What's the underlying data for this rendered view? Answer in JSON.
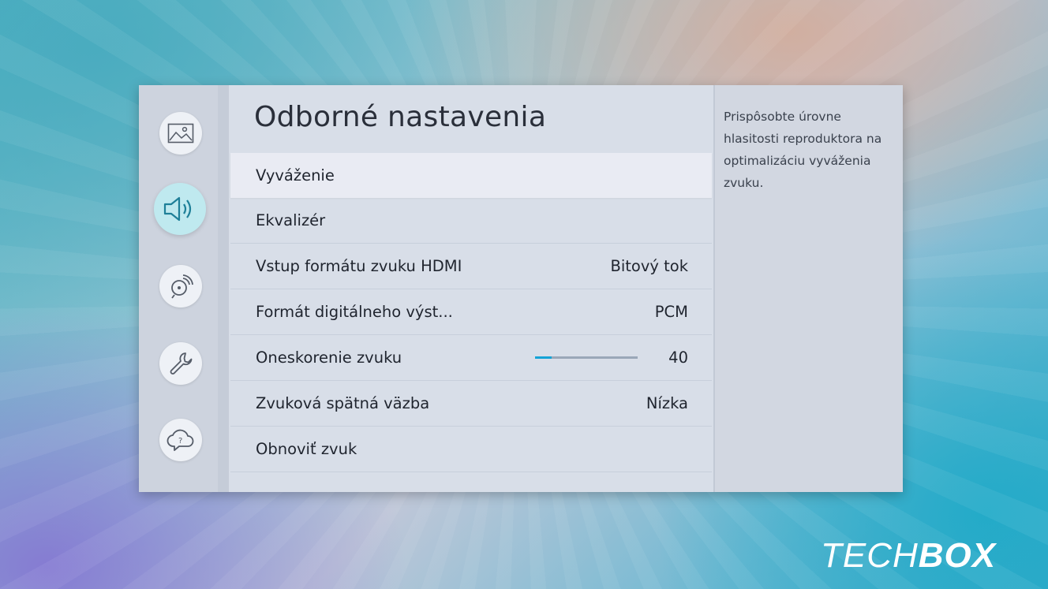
{
  "sidebar": {
    "items": [
      {
        "icon": "picture-icon",
        "active": false
      },
      {
        "icon": "sound-icon",
        "active": true
      },
      {
        "icon": "broadcast-icon",
        "active": false
      },
      {
        "icon": "wrench-icon",
        "active": false
      },
      {
        "icon": "support-icon",
        "active": false
      }
    ]
  },
  "main": {
    "title": "Odborné nastavenia",
    "items": [
      {
        "label": "Vyváženie",
        "value": ""
      },
      {
        "label": "Ekvalizér",
        "value": ""
      },
      {
        "label": "Vstup formátu zvuku HDMI",
        "value": "Bitový tok"
      },
      {
        "label": "Formát digitálneho výst...",
        "value": "PCM"
      },
      {
        "label": "Oneskorenie zvuku",
        "value": "40",
        "slider_fraction": 0.16
      },
      {
        "label": "Zvuková spätná väzba",
        "value": "Nízka"
      },
      {
        "label": "Obnoviť zvuk",
        "value": ""
      }
    ]
  },
  "description": "Prispôsobte úrovne hlasitosti reproduktora na optimalizáciu vyváženia zvuku.",
  "watermark": {
    "part1": "TECH",
    "part2": "BOX"
  },
  "colors": {
    "accent": "#15a3d6",
    "active_icon_bg": "#bfe9ef"
  }
}
